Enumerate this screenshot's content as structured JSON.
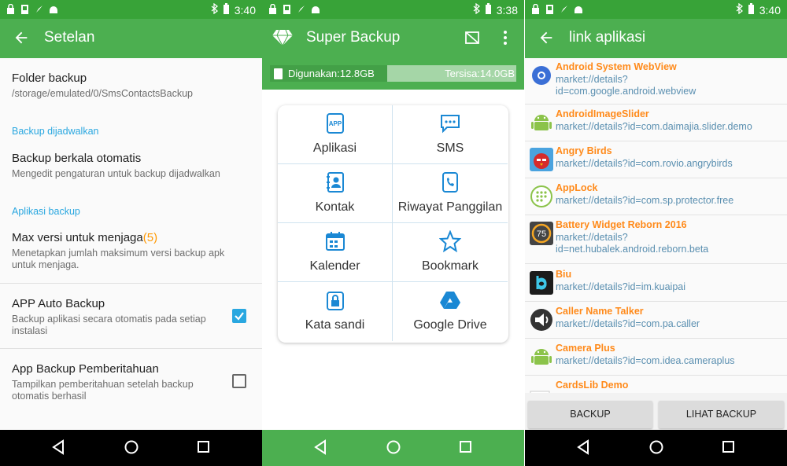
{
  "colors": {
    "accent": "#4caf50",
    "status_bar": "#38a338",
    "category": "#29a7e0",
    "app_name": "#ff8a1a",
    "app_link": "#5a8fb0",
    "icon_blue": "#1a88d4"
  },
  "panel1": {
    "status": {
      "time": "3:40"
    },
    "title": "Setelan",
    "folder": {
      "title": "Folder backup",
      "summary": "/storage/emulated/0/SmsContactsBackup"
    },
    "cat_scheduled": "Backup dijadwalkan",
    "periodic": {
      "title": "Backup berkala otomatis",
      "summary": "Mengedit pengaturan untuk backup dijadwalkan"
    },
    "cat_apps": "Aplikasi backup",
    "max_versions": {
      "title": "Max versi untuk menjaga",
      "count": "(5)",
      "summary_line1": "Menetapkan jumlah maksimum versi backup apk",
      "summary_line2": "untuk menjaga."
    },
    "auto_backup": {
      "title": "APP Auto Backup",
      "summary_line1": "Backup aplikasi secara otomatis pada setiap",
      "summary_line2": "instalasi",
      "checked": true
    },
    "notify": {
      "title": "App Backup Pemberitahuan",
      "summary_line1": "Tampilkan pemberitahuan setelah backup",
      "summary_line2": "otomatis berhasil",
      "checked": false
    }
  },
  "panel2": {
    "status": {
      "time": "3:38"
    },
    "title": "Super Backup",
    "storage": {
      "used": "Digunakan:12.8GB",
      "free": "Tersisa:14.0GB",
      "used_fraction": 0.477
    },
    "grid": [
      "Aplikasi",
      "SMS",
      "Kontak",
      "Riwayat Panggilan",
      "Kalender",
      "Bookmark",
      "Kata sandi",
      "Google Drive"
    ],
    "grid_icons": [
      "app-icon",
      "sms-icon",
      "contacts-icon",
      "call-log-icon",
      "calendar-icon",
      "bookmark-star-icon",
      "password-lock-icon",
      "google-drive-icon"
    ]
  },
  "panel3": {
    "status": {
      "time": "3:40"
    },
    "title": "link aplikasi",
    "apps": [
      {
        "name": "Android System WebView",
        "link1": "market://details?",
        "link2": "id=com.google.android.webview"
      },
      {
        "name": "AndroidImageSlider",
        "link1": "market://details?id=com.daimajia.slider.demo",
        "link2": ""
      },
      {
        "name": "Angry Birds",
        "link1": "market://details?id=com.rovio.angrybirds",
        "link2": ""
      },
      {
        "name": "AppLock",
        "link1": "market://details?id=com.sp.protector.free",
        "link2": ""
      },
      {
        "name": "Battery Widget Reborn 2016",
        "link1": "market://details?",
        "link2": "id=net.hubalek.android.reborn.beta"
      },
      {
        "name": "Biu",
        "link1": "market://details?id=im.kuaipai",
        "link2": ""
      },
      {
        "name": "Caller Name Talker",
        "link1": "market://details?id=com.pa.caller",
        "link2": ""
      },
      {
        "name": "Camera Plus",
        "link1": "market://details?id=com.idea.cameraplus",
        "link2": ""
      },
      {
        "name": "CardsLib Demo",
        "link1": "",
        "link2": ""
      }
    ],
    "battery_icon_text": "75",
    "buttons": {
      "backup": "BACKUP",
      "view": "LIHAT BACKUP"
    }
  }
}
